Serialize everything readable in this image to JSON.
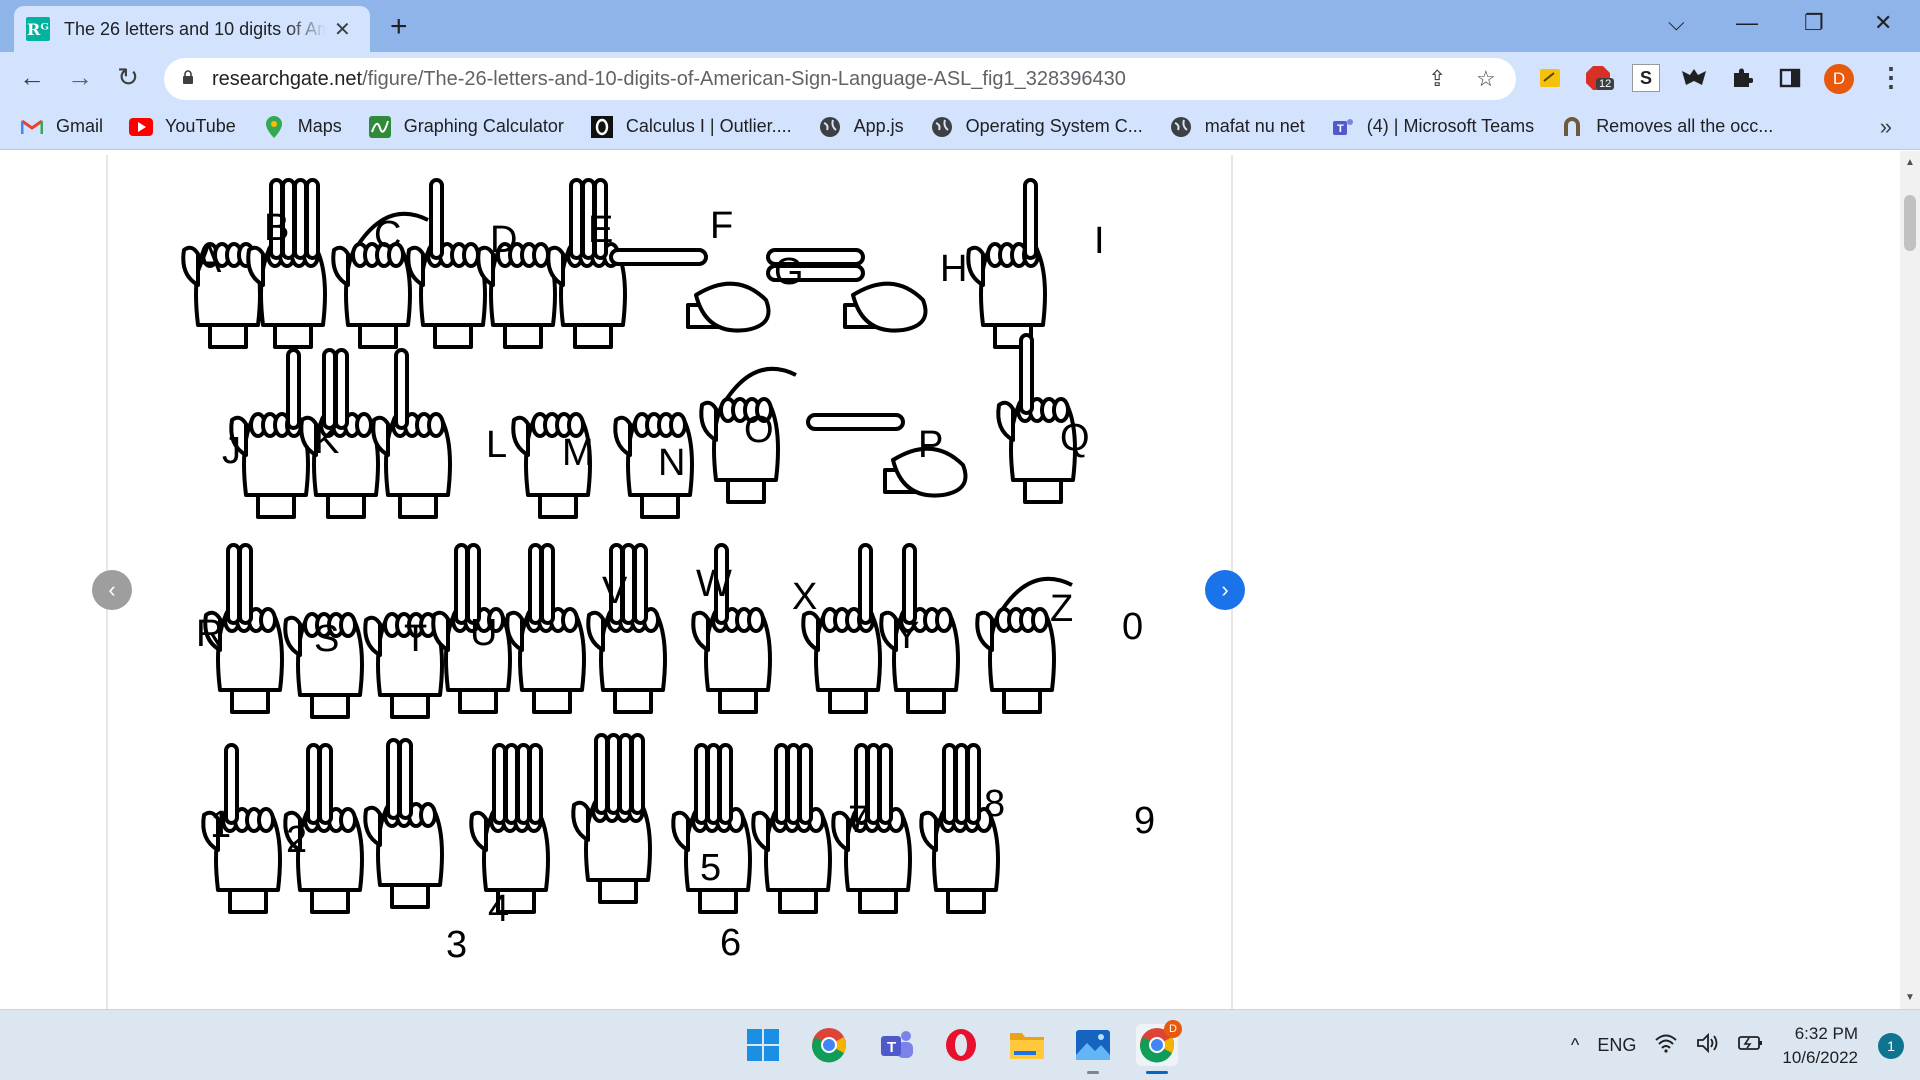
{
  "tab": {
    "favicon_text": "Rᴳ",
    "title": "The 26 letters and 10 digits of American Sign Language (ASL)",
    "close_glyph": "✕"
  },
  "new_tab_glyph": "+",
  "window_controls": {
    "tab_search": "⌵",
    "minimize": "—",
    "restore": "❐",
    "close": "✕"
  },
  "toolbar": {
    "back": "←",
    "forward": "→",
    "reload": "↻",
    "url_host": "researchgate.net",
    "url_path": "/figure/The-26-letters-and-10-digits-of-American-Sign-Language-ASL_fig1_328396430",
    "share_glyph": "⇪",
    "star_glyph": "☆",
    "extension_badge": "12",
    "extension_s": "S",
    "profile_initial": "D",
    "menu_glyph": "⋮"
  },
  "bookmarks": [
    {
      "label": "Gmail",
      "icon": "gmail-icon"
    },
    {
      "label": "YouTube",
      "icon": "youtube-icon"
    },
    {
      "label": "Maps",
      "icon": "maps-icon"
    },
    {
      "label": "Graphing Calculator",
      "icon": "desmos-icon"
    },
    {
      "label": "Calculus I | Outlier....",
      "icon": "outlier-icon"
    },
    {
      "label": "App.js",
      "icon": "globe-icon"
    },
    {
      "label": "Operating System C...",
      "icon": "globe-icon"
    },
    {
      "label": "mafat nu net",
      "icon": "globe-icon"
    },
    {
      "label": "(4) | Microsoft Teams",
      "icon": "teams-icon"
    },
    {
      "label": "Removes all the occ...",
      "icon": "horseshoe-icon"
    }
  ],
  "bookmarks_more": "»",
  "figure": {
    "letters": {
      "A": "A",
      "B": "B",
      "C": "C",
      "D": "D",
      "E": "E",
      "F": "F",
      "G": "G",
      "H": "H",
      "I": "I",
      "J": "J",
      "K": "K",
      "L": "L",
      "M": "M",
      "N": "N",
      "O": "O",
      "P": "P",
      "Q": "Q",
      "R": "R",
      "S": "S",
      "T": "T",
      "U": "U",
      "V": "V",
      "W": "W",
      "X": "X",
      "Y": "Y",
      "Z": "Z",
      "zero": "0",
      "d1": "1",
      "d2": "2",
      "d3": "3",
      "d4": "4",
      "d5": "5",
      "d6": "6",
      "d7": "7",
      "d8": "8",
      "d9": "9"
    },
    "prev_glyph": "‹",
    "next_glyph": "›"
  },
  "taskbar": {
    "tray_caret": "^",
    "language": "ENG",
    "time": "6:32 PM",
    "date": "10/6/2022",
    "notification_count": "1",
    "chrome_badge": "D"
  },
  "colors": {
    "tabstrip": "#8fb4ea",
    "toolbar": "#d3e3fd",
    "next_button": "#1a73e8",
    "profile": "#e8590c"
  }
}
